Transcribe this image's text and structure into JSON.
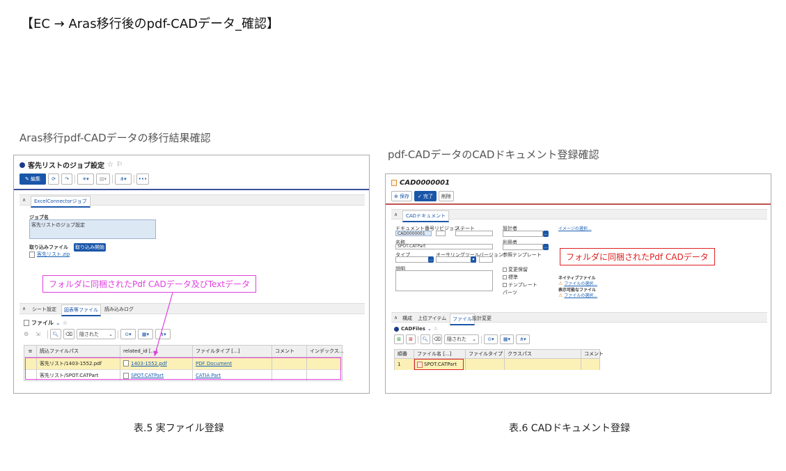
{
  "slide_title": "【EC → Aras移行後のpdf-CADデータ_確認】",
  "left": {
    "caption": "Aras移行pdf-CADデータの移行結果確認",
    "table_caption": "表.5 実ファイル登録",
    "window": {
      "title": "客先リストのジョブ設定",
      "edit_label": "編集",
      "tab_label": "ExcelConnectorジョブ",
      "job_name_label": "ジョブ名",
      "job_name_value": "客先リストのジョブ設定",
      "import_file_label": "取り込みファイル",
      "import_button": "取り込み開始",
      "import_file_link": "客先リスト.zip",
      "tabs": [
        "シート設定",
        "図表等ファイル",
        "読み込みログ"
      ],
      "files_title": "ファイル",
      "hidden_select": "隠された",
      "columns": [
        "読込ファイルパス",
        "related_id [...]",
        "ファイルタイプ [...]",
        "コメント",
        "インデックス..."
      ],
      "rows": [
        {
          "path": "客先リスト/1403-1552.pdf",
          "related": "1403-1552.pdf",
          "type": "PDF Document"
        },
        {
          "path": "客先リスト/SPOT.CATPart",
          "related": "SPOT.CATPart",
          "type": "CATIA Part"
        }
      ]
    },
    "annotation": "フォルダに同梱されたPdf CADデータ及びTextデータ",
    "annotation_color": "#e040e0"
  },
  "right": {
    "caption": "pdf-CADデータのCADドキュメント登録確認",
    "table_caption": "表.6 CADドキュメント登録",
    "window": {
      "title": "CAD0000001",
      "save_label": "保存",
      "done_label": "完了",
      "delete_label": "削除",
      "section_label": "CADドキュメント",
      "doc_number_label": "ドキュメント番号",
      "doc_number_value": "CAD0000001",
      "revision_label": "リビジョン",
      "state_label": "ステート",
      "designer_label": "設計者",
      "image_select_link": "イメージの選択...",
      "name_label": "名称",
      "name_value": "SPOT.CATPart",
      "type_label": "タイプ",
      "authoring_tool_label": "オーサリングツール",
      "version_label": "バージョン",
      "reference_template_label": "参照テンプレート",
      "description_label": "説明",
      "change_hold_label": "変更保留",
      "standard_label": "標準",
      "template_label": "テンプレート",
      "parts_label": "パーツ",
      "native_file_label": "ネイティブファイル",
      "native_file_link": "ファイルの選択...",
      "viewable_file_label": "表示可能なファイル",
      "viewable_file_link": "ファイルの選択...",
      "usage_label": "利用者",
      "tabs": [
        "構成",
        "上位アイテム",
        "ファイル",
        "設計変更"
      ],
      "files_title": "CADFiles",
      "hidden_select": "隠された",
      "columns": [
        "順番",
        "ファイル名 [...]",
        "ファイルタイプ",
        "クラスパス",
        "コメント"
      ],
      "rows": [
        {
          "order": "1",
          "file": "SPOT.CATPart"
        }
      ]
    },
    "annotation": "フォルダに同梱されたPdf CADデータ",
    "annotation_color": "#e02020"
  }
}
